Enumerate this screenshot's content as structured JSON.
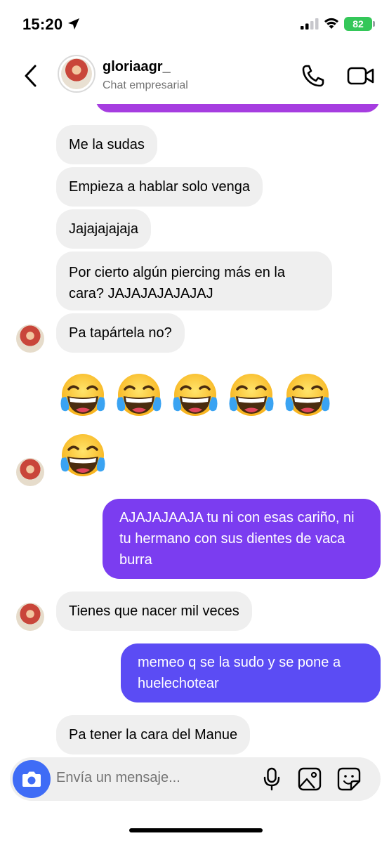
{
  "status": {
    "time": "15:20",
    "battery": "82"
  },
  "header": {
    "username": "gloriaagr_",
    "subtitle": "Chat empresarial"
  },
  "messages": [
    {
      "side": "in",
      "text": "Me la sudas"
    },
    {
      "side": "in",
      "text": "Empieza a hablar solo venga"
    },
    {
      "side": "in",
      "text": "Jajajajajaja"
    },
    {
      "side": "in",
      "text": "Por cierto algún piercing más en la cara? JAJAJAJAJAJAJ"
    },
    {
      "side": "in",
      "text": "Pa tapártela no?"
    },
    {
      "side": "in",
      "text": "AJAJAJAAJA tu ni con esas cariño, ni tu hermano con sus dientes de vaca burra",
      "note": ""
    },
    {
      "side": "in",
      "text": "Tienes que nacer mil veces"
    },
    {
      "side": "out",
      "text": "memeo q se la sudo y se pone a huelechotear"
    },
    {
      "side": "in",
      "text": "Pa tener la cara del Manue"
    }
  ],
  "emoji_reactions": {
    "row_count": 5,
    "single_count": 1,
    "name": "face-with-tears-of-joy"
  },
  "composer": {
    "placeholder": "Envía un mensaje..."
  },
  "colors": {
    "incoming_bubble": "#efefef",
    "outgoing_bubble_top": "#7b3df0",
    "outgoing_bubble_bottom": "#5b4cf4",
    "camera_button": "#3f6cf6",
    "purple_partial": "#a63de0",
    "battery": "#34c759"
  },
  "icons": [
    "location-arrow-icon",
    "signal-icon",
    "wifi-icon",
    "battery-icon",
    "back-chevron-icon",
    "phone-icon",
    "video-camera-icon",
    "camera-icon",
    "microphone-icon",
    "image-icon",
    "sticker-icon"
  ]
}
